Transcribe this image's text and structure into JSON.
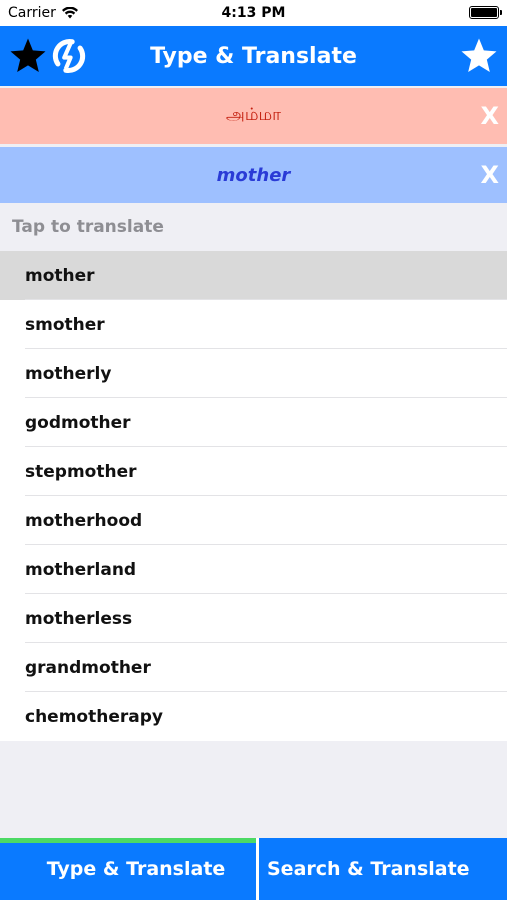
{
  "status_bar": {
    "carrier": "Carrier",
    "time": "4:13 PM"
  },
  "nav": {
    "title": "Type & Translate",
    "left_icons": [
      "star-icon",
      "sync-icon"
    ],
    "right_icon": "star-outline-icon"
  },
  "results": {
    "tamil_text": "அம்மா",
    "english_text": "mother",
    "clear_label": "X"
  },
  "suggestions": {
    "header": "Tap to translate",
    "items": [
      "mother",
      "smother",
      "motherly",
      "godmother",
      "stepmother",
      "motherhood",
      "motherland",
      "motherless",
      "grandmother",
      "chemotherapy"
    ],
    "selected_index": 0
  },
  "tabs": [
    {
      "label": "Type & Translate",
      "active": true
    },
    {
      "label": "Search & Translate",
      "active": false
    }
  ],
  "colors": {
    "primary": "#0a7aff",
    "tamil_bg": "#ffbdb2",
    "english_bg": "#9ec0ff",
    "active_tab_indicator": "#4cd964"
  }
}
